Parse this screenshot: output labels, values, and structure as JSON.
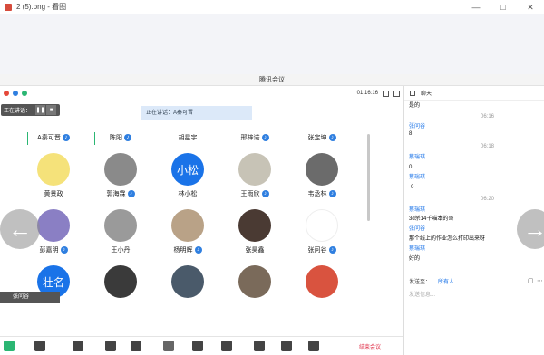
{
  "window": {
    "title": "2 (5).png - 看图",
    "controls": [
      "—",
      "□",
      "✕"
    ]
  },
  "meeting": {
    "bar_title": "腾讯会议",
    "timer": "01:16:16",
    "chat_tab": "聊天",
    "speaking_chip": "正在讲话：",
    "banner": "正在讲话：A秦可晋",
    "self_label": "张问谷",
    "leave_label": "结束会议"
  },
  "participants_row1": [
    {
      "name": "A秦可晋",
      "mic": true
    },
    {
      "name": "陈阳",
      "mic": true
    },
    {
      "name": "胡星宇",
      "mic": false
    },
    {
      "name": "邢梓诺",
      "mic": true
    },
    {
      "name": "张定坤",
      "mic": true
    }
  ],
  "participants_row2": [
    {
      "name": "黄景政",
      "mic": false,
      "avatar_color": "#f5e27a"
    },
    {
      "name": "郭海霖",
      "mic": true,
      "avatar_color": "#8a8a8a"
    },
    {
      "name": "林小松",
      "mic": false,
      "avatar_text": "小松",
      "avatar_color": "#1a73e8"
    },
    {
      "name": "王雨欣",
      "mic": true,
      "avatar_color": "#c7c3b6"
    },
    {
      "name": "韦丞林",
      "mic": true,
      "avatar_color": "#6b6b6b"
    }
  ],
  "participants_row3": [
    {
      "name": "彭嘉明",
      "mic": true,
      "avatar_color": "#8a7fc4"
    },
    {
      "name": "王小丹",
      "mic": false,
      "avatar_color": "#9a9a9a"
    },
    {
      "name": "杨明辉",
      "mic": true,
      "avatar_color": "#b9a287"
    },
    {
      "name": "张昊鑫",
      "mic": false,
      "avatar_color": "#4a3a33"
    },
    {
      "name": "张问谷",
      "mic": true,
      "avatar_color": "#ffffff"
    }
  ],
  "participants_row4": [
    {
      "avatar_text": "壮名",
      "avatar_color": "#1a73e8"
    },
    {
      "avatar_color": "#3a3a3a"
    },
    {
      "avatar_color": "#4a5a6a"
    },
    {
      "avatar_color": "#7a6a5a"
    },
    {
      "avatar_color": "#d9533f"
    }
  ],
  "chat": {
    "messages": [
      {
        "kind": "text",
        "value": "是的"
      },
      {
        "kind": "time",
        "value": "06:16"
      },
      {
        "kind": "sender",
        "value": "张问谷"
      },
      {
        "kind": "text",
        "value": "8"
      },
      {
        "kind": "time",
        "value": "06:18"
      },
      {
        "kind": "sender",
        "value": "蔡瑞琪"
      },
      {
        "kind": "text",
        "value": "0."
      },
      {
        "kind": "sender",
        "value": "蔡瑞琪"
      },
      {
        "kind": "text",
        "value": "-0-"
      },
      {
        "kind": "time",
        "value": "06:20"
      },
      {
        "kind": "sender",
        "value": "蔡瑞琪"
      },
      {
        "kind": "text",
        "value": "3d杀14千喵本的哥"
      },
      {
        "kind": "sender",
        "value": "张问谷"
      },
      {
        "kind": "text",
        "value": "那个线上的作业怎么打印出来呀"
      },
      {
        "kind": "sender",
        "value": "蔡瑞琪"
      },
      {
        "kind": "text",
        "value": "好的"
      }
    ],
    "send_to_label": "发送至：",
    "send_to_value": "所有人",
    "input_placeholder": "发送信息..."
  }
}
